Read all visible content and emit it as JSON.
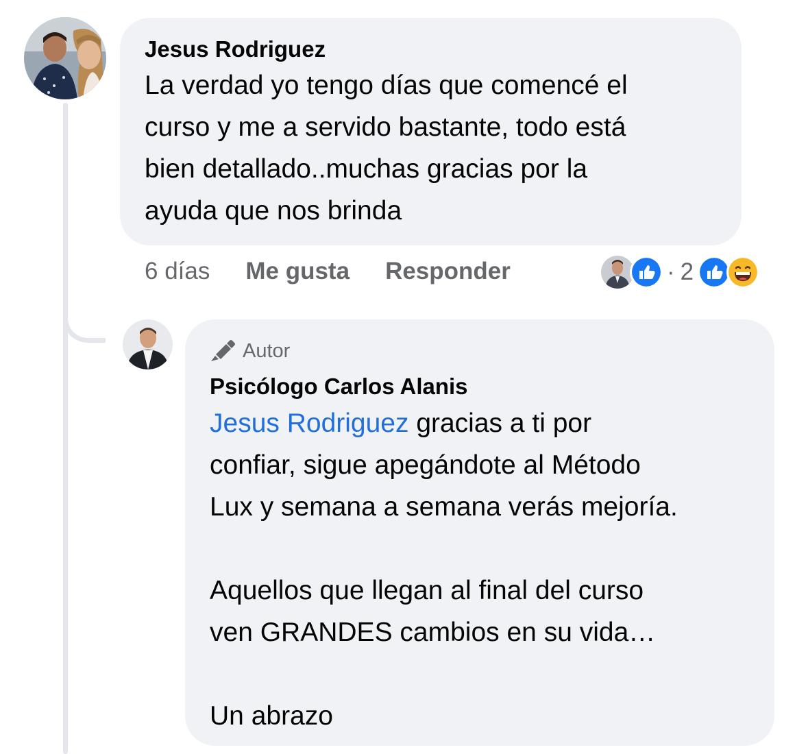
{
  "comment": {
    "author": "Jesus Rodriguez",
    "text": "La verdad yo tengo días que comencé el curso y me a servido bastante, todo está bien detallado..muchas gracias por la ayuda que nos brinda",
    "lines": [
      "La verdad yo tengo días que comencé el",
      "curso y me a servido bastante, todo está",
      "bien detallado..muchas gracias por la",
      "ayuda que nos brinda"
    ],
    "timestamp": "6 días",
    "like_label": "Me gusta",
    "reply_label": "Responder",
    "reactions": {
      "separator": "·",
      "count": "2",
      "types": [
        "like-icon",
        "haha-icon"
      ]
    }
  },
  "reply": {
    "badge": "Autor",
    "badge_icon": "author-pen-icon",
    "author": "Psicólogo Carlos Alanis",
    "mention": "Jesus Rodriguez",
    "line1_rest": " gracias a ti por",
    "lines": [
      "confiar, sigue apegándote al Método",
      "Lux y semana a semana verás mejoría."
    ],
    "paragraph2": [
      "Aquellos que llegan al final del curso",
      "ven GRANDES cambios en su vida…"
    ],
    "paragraph3": "Un abrazo"
  },
  "colors": {
    "bubble": "#f0f2f5",
    "mention": "#216fdb",
    "secondary_text": "#65676b",
    "like_blue": "#1877f2",
    "thread_line": "#e4e6eb"
  }
}
